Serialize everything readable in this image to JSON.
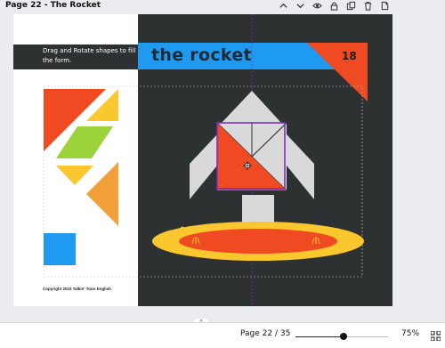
{
  "header": {
    "page_title": "Page 22 - The Rocket",
    "icons": [
      "chevron-up-icon",
      "chevron-down-icon",
      "eye-icon",
      "lock-icon",
      "duplicate-icon",
      "trash-icon",
      "add-page-icon"
    ]
  },
  "page": {
    "instructions": "Drag and Rotate shapes to fill the form.",
    "title": "the rocket",
    "number": "18",
    "copyright": "Copyright 2023 Talkin' Toon English",
    "colors": {
      "dark": "#2e3132",
      "blue": "#1e9af0",
      "red": "#f04a22",
      "yellow": "#fbc72e",
      "green": "#9cd33b",
      "orange": "#f2a03a",
      "grey": "#d9d9d9",
      "selection": "#7b2fbf"
    }
  },
  "footer": {
    "page_counter": "Page 22 / 35",
    "zoom_level": "75%",
    "zoom_fraction": 0.52
  }
}
